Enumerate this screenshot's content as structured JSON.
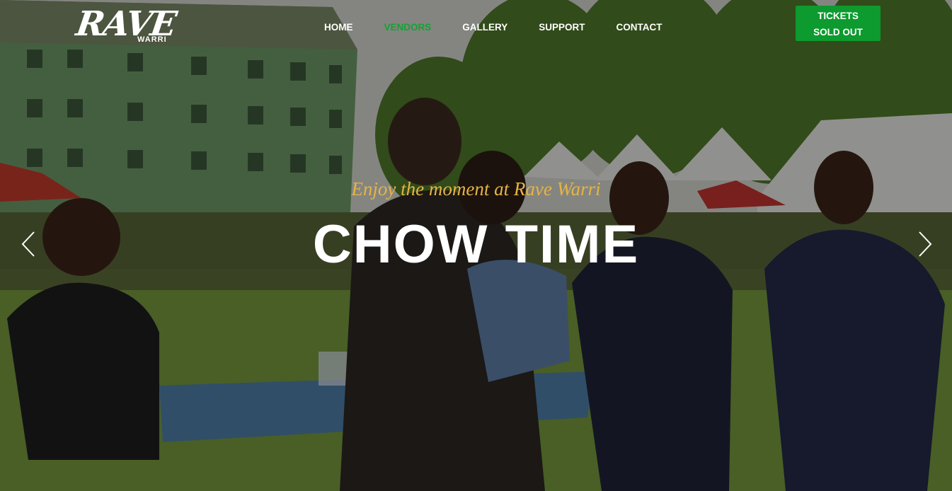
{
  "brand": {
    "logo_main": "RAVE",
    "logo_sub": "WARRI"
  },
  "nav": {
    "items": [
      {
        "label": "HOME"
      },
      {
        "label": "VENDORS"
      },
      {
        "label": "GALLERY"
      },
      {
        "label": "SUPPORT"
      },
      {
        "label": "CONTACT"
      }
    ],
    "active_index": 1,
    "active_color": "#14a232"
  },
  "cta": {
    "line1": "TICKETS",
    "line2": "SOLD OUT",
    "color": "#0d9a2e"
  },
  "slide": {
    "tagline": "Enjoy the moment at Rave Warri",
    "headline": "CHOW TIME",
    "tagline_color": "#e5b445"
  },
  "controls": {
    "prev_icon": "chevron-left-icon",
    "next_icon": "chevron-right-icon"
  }
}
